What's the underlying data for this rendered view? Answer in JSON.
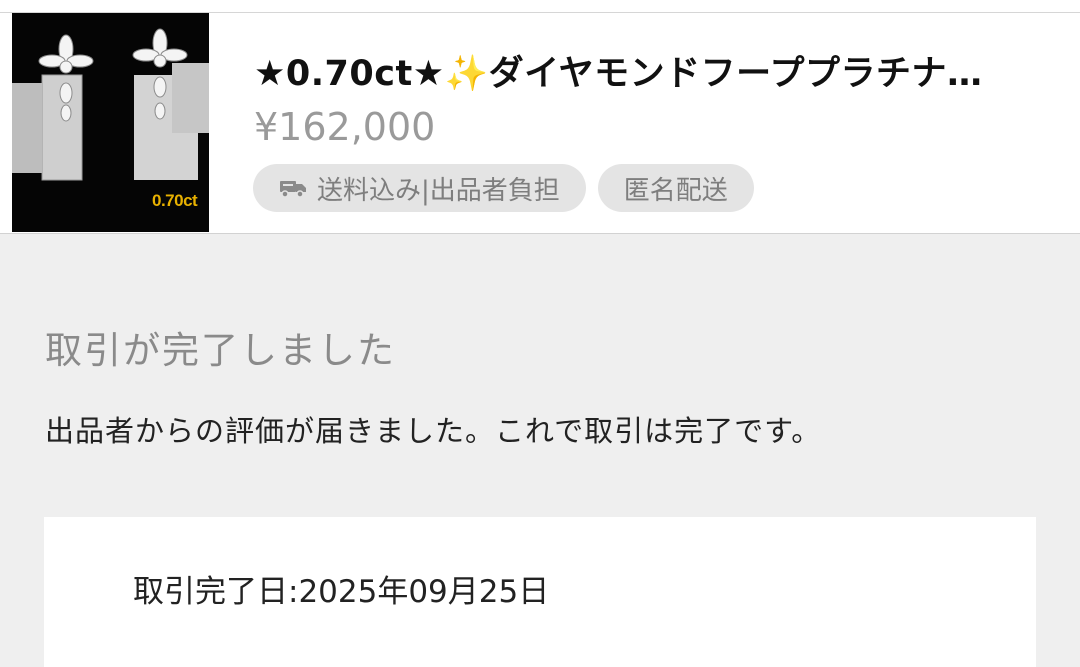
{
  "item": {
    "title": "★0.70ct★✨ダイヤモンドフーププラチナ…",
    "price": "¥162,000",
    "thumbnail_label": "0.70ct",
    "chips": [
      {
        "label": "送料込み|出品者負担",
        "icon": "truck-icon"
      },
      {
        "label": "匿名配送"
      }
    ]
  },
  "status": {
    "heading": "取引が完了しました",
    "message": "出品者からの評価が届きました。これで取引は完了です。"
  },
  "detail": {
    "completion_date": "取引完了日:2025年09月25日"
  }
}
